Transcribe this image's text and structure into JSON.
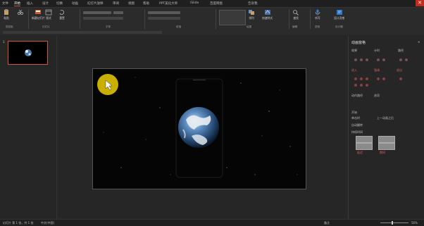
{
  "tabs": [
    "文件",
    "开始",
    "插入",
    "设计",
    "切换",
    "动画",
    "幻灯片放映",
    "审阅",
    "视图",
    "帮助",
    "PPT美化大师",
    "iSlide",
    "百度网盘",
    "告诉我"
  ],
  "active_tab_index": 1,
  "close_glyph": "✕",
  "ribbon": {
    "groups": [
      "剪贴板",
      "幻灯片",
      "字体",
      "段落",
      "绘图",
      "编辑",
      "语音",
      "设计器"
    ],
    "buttons": [
      "粘贴",
      "新建幻灯片",
      "版式",
      "重置",
      "节",
      "绘图",
      "排列",
      "快速样式",
      "查找",
      "替换",
      "选择",
      "听写",
      "设计灵感"
    ]
  },
  "slide": {
    "number": "1",
    "background": "#050505",
    "cursor_color": "#d4b800"
  },
  "right_pane": {
    "title": "动画窗格",
    "labels": [
      "效果",
      "计时",
      "路径",
      "选项",
      "开始",
      "延迟",
      "期间",
      "重复",
      "单击时",
      "上一动画之后",
      "自动翻转",
      "持续时间"
    ],
    "red_labels": [
      "进入",
      "强调",
      "退出",
      "动作路径"
    ]
  },
  "status": {
    "slide_indicator": "幻灯片 第 1 张，共 1 张",
    "language": "中文(中国)",
    "notes": "备注",
    "zoom": "56%"
  },
  "colors": {
    "accent": "#c55a3c",
    "close": "#c42b1c",
    "cursor": "#d4b800"
  }
}
